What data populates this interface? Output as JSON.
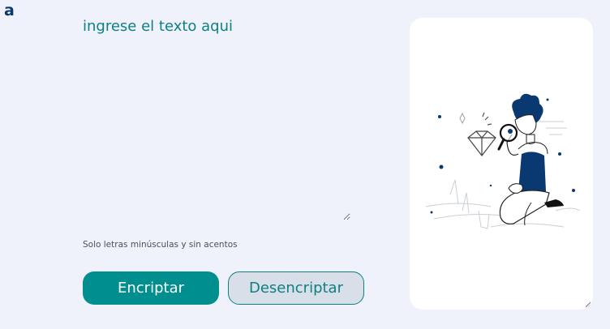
{
  "logo": {
    "text": "a"
  },
  "input": {
    "placeholder": "ingrese el texto aqui",
    "value": ""
  },
  "hint": {
    "text": "Solo letras minúsculas y sin acentos"
  },
  "buttons": {
    "encrypt_label": "Encriptar",
    "decrypt_label": "Desencriptar"
  },
  "output": {
    "value": "",
    "illustration": "person-searching-with-magnifier-illustration"
  },
  "colors": {
    "background": "#eff2fb",
    "primary": "#008e8e",
    "text_accent": "#0e7f83",
    "logo": "#0a3871",
    "secondary_button": "#d8dfe8",
    "panel": "#ffffff"
  },
  "icons": [
    "logo-mark",
    "diamond-icon",
    "magnifier-icon",
    "textarea-resize-grip-icon"
  ]
}
